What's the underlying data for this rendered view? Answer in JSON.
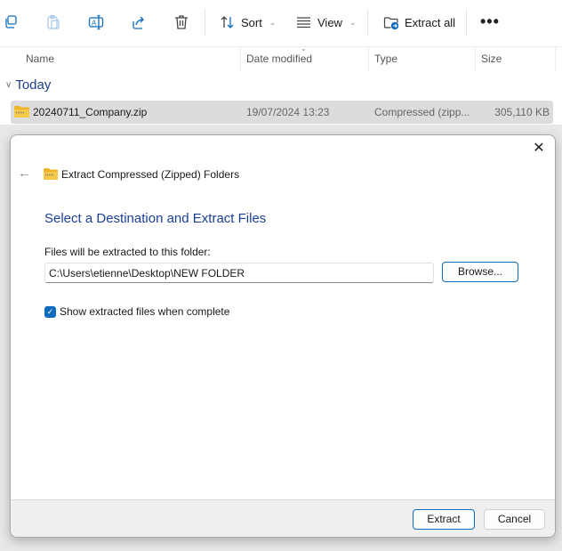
{
  "toolbar": {
    "icons": [
      "copy-icon",
      "paste-icon",
      "rename-icon",
      "share-icon",
      "delete-icon"
    ],
    "sort_label": "Sort",
    "view_label": "View",
    "extract_all_label": "Extract all",
    "more_label": "•••"
  },
  "columns": {
    "name": "Name",
    "date_modified": "Date modified",
    "type": "Type",
    "size": "Size"
  },
  "group": {
    "label": "Today"
  },
  "files": [
    {
      "name": "20240711_Company.zip",
      "date_modified": "19/07/2024 13:23",
      "type": "Compressed (zipp...",
      "size": "305,110 KB"
    }
  ],
  "dialog": {
    "title": "Extract Compressed (Zipped) Folders",
    "heading": "Select a Destination and Extract Files",
    "folder_label": "Files will be extracted to this folder:",
    "folder_value": "C:\\Users\\etienne\\Desktop\\NEW FOLDER",
    "browse_label": "Browse...",
    "show_files_label": "Show extracted files when complete",
    "show_files_checked": true,
    "extract_label": "Extract",
    "cancel_label": "Cancel",
    "close_label": "✕",
    "back_label": "←"
  },
  "colors": {
    "accent": "#0f6cbd",
    "heading": "#1a3f96",
    "selection": "#dcdcdc"
  }
}
